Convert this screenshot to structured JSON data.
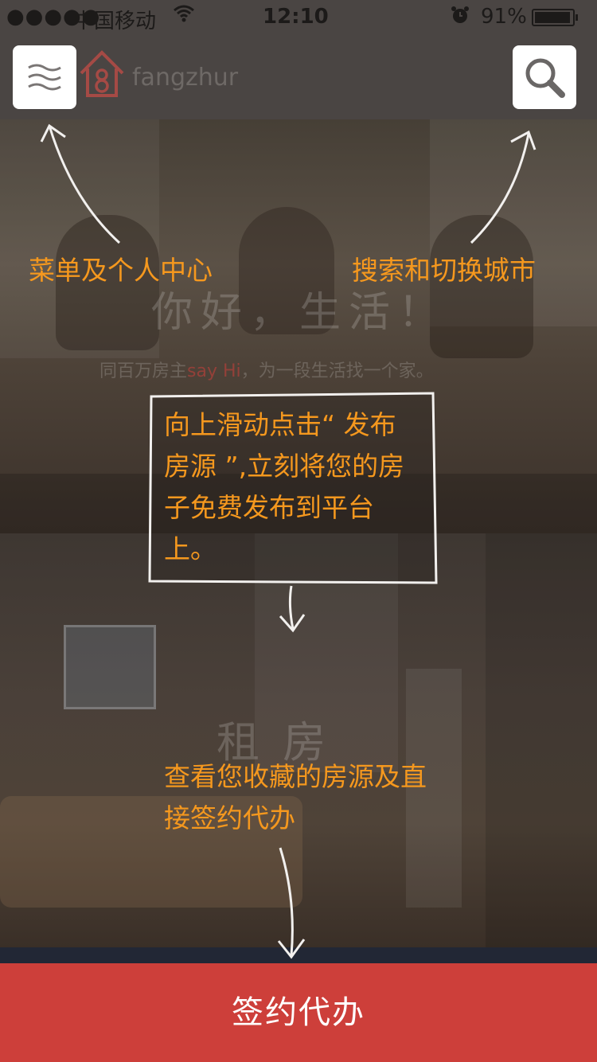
{
  "status_bar": {
    "signal": "●●●●●",
    "carrier": "中国移动",
    "time": "12:10",
    "battery": "91%"
  },
  "header": {
    "brand": "fangzhur",
    "menu_icon": "menu-wave-icon",
    "search_icon": "search-icon"
  },
  "background": {
    "slogan": "你好，生活！",
    "sub_prefix": "同百万房主",
    "sub_highlight": "say Hi",
    "sub_suffix": "，为一段生活找一个家。",
    "section_title": "租 房"
  },
  "annotations": {
    "menu": "菜单及个人中心",
    "search": "搜索和切换城市",
    "publish": "向上滑动点击“ 发布房源 ”,立刻将您的房子免费发布到平台上。",
    "favorites": "查看您收藏的房源及直接签约代办"
  },
  "bottom_button": {
    "label": "签约代办"
  },
  "colors": {
    "accent": "#f5981e",
    "bottom": "#cd3f3a",
    "overlay": "#4a4543"
  }
}
